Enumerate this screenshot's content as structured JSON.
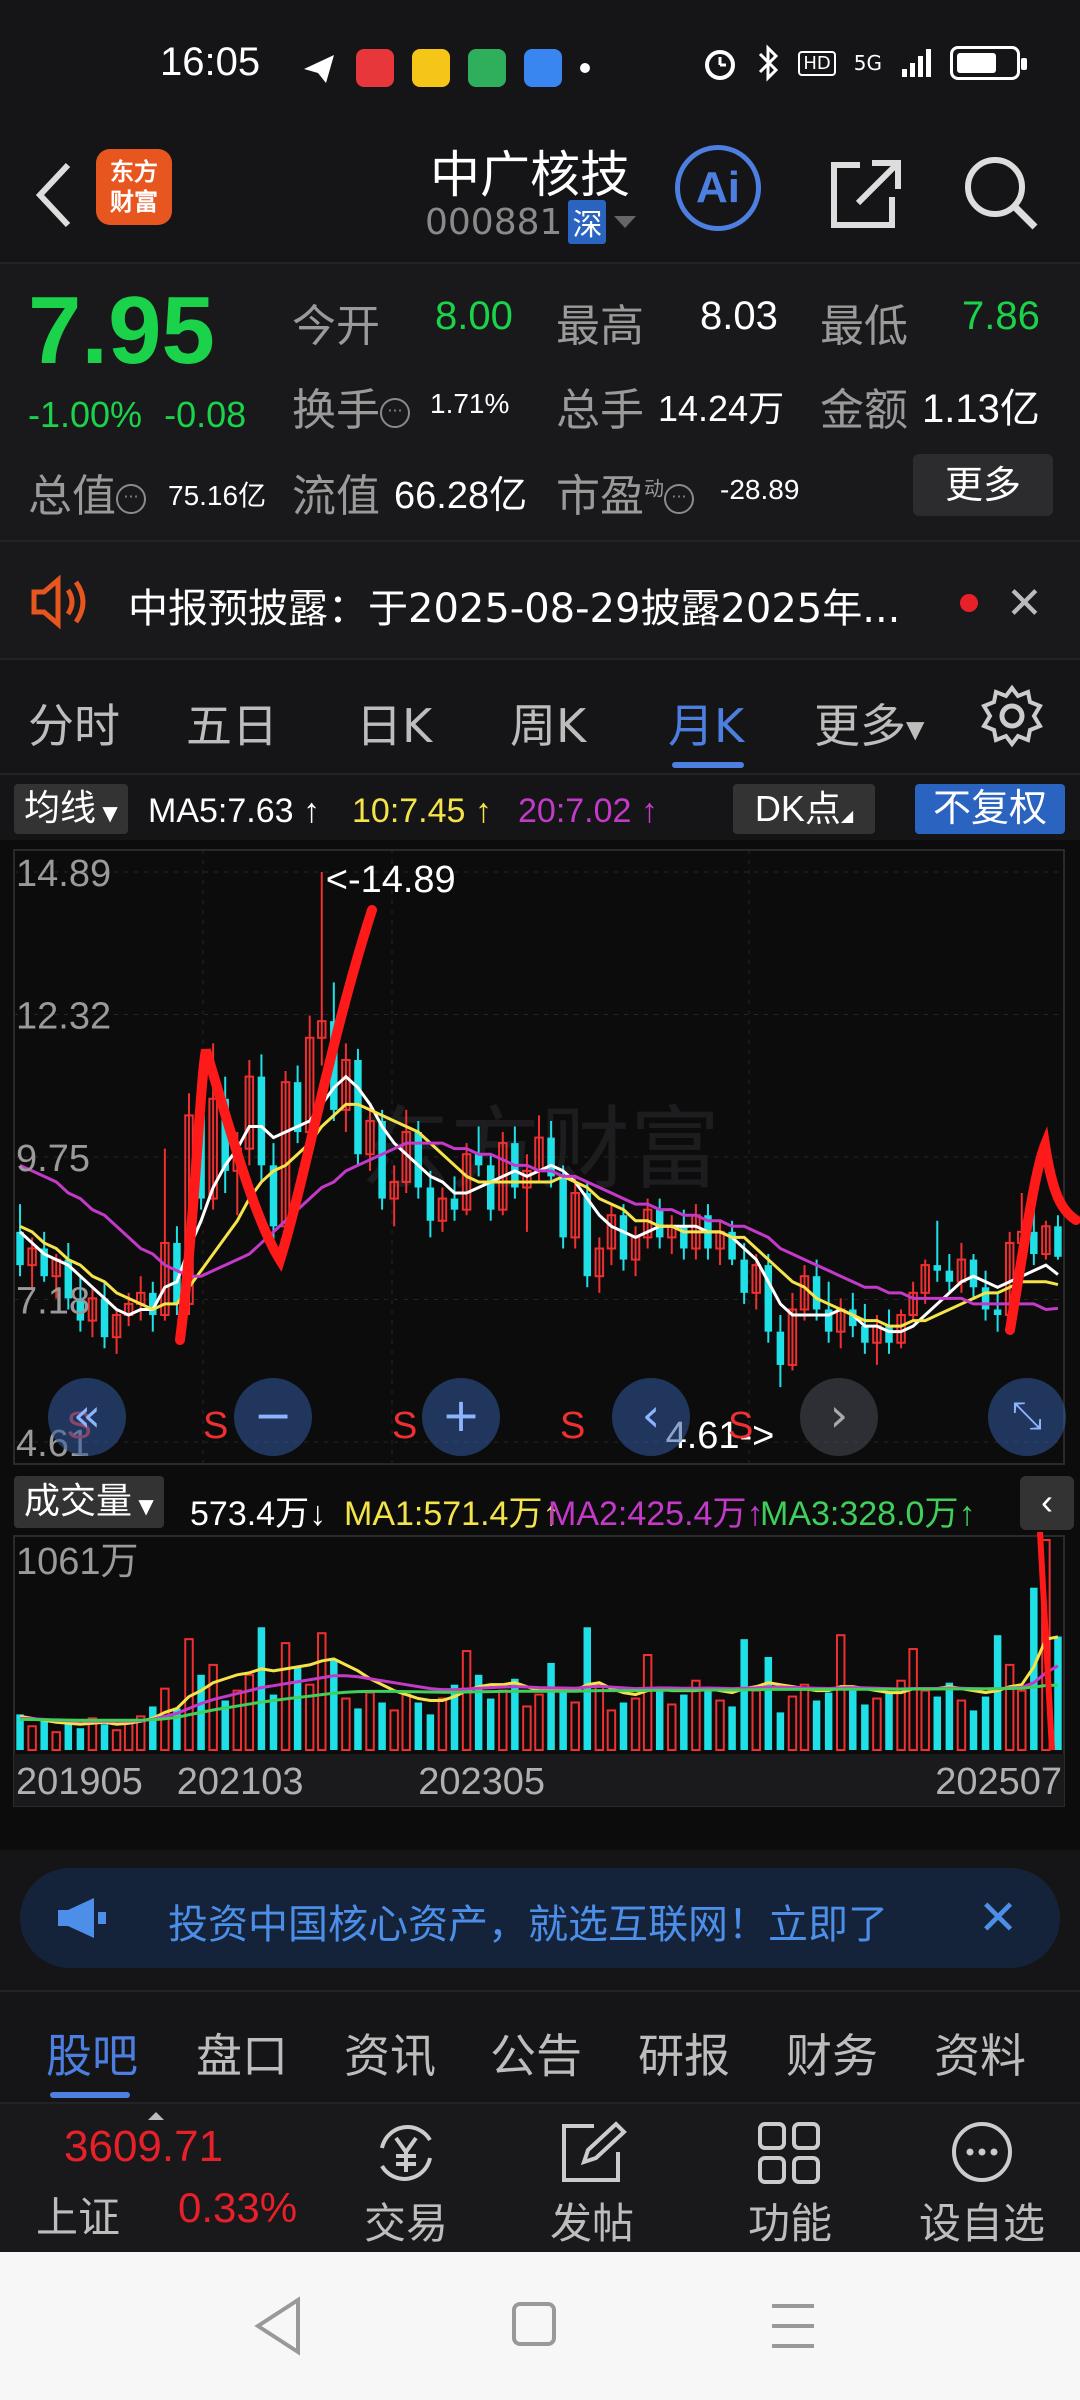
{
  "status": {
    "time": "16:05",
    "network": "5G",
    "battery_level": 0.7
  },
  "header": {
    "logo_text": "东方\n财富",
    "stock_name": "中广核技",
    "stock_code": "000881",
    "market": "深",
    "ai_label": "Ai"
  },
  "quote": {
    "price": "7.95",
    "change_pct": "-1.00%",
    "change_amt": "-0.08",
    "open_label": "今开",
    "open": "8.00",
    "high_label": "最高",
    "high": "8.03",
    "low_label": "最低",
    "low": "7.86",
    "turnover_label": "换手",
    "turnover": "1.71%",
    "volume_label": "总手",
    "volume": "14.24万",
    "amount_label": "金额",
    "amount": "1.13亿",
    "mktcap_label": "总值",
    "mktcap": "75.16亿",
    "float_label": "流值",
    "float": "66.28亿",
    "pe_label": "市盈",
    "pe_sup": "动",
    "pe": "-28.89",
    "more_label": "更多"
  },
  "notice": {
    "text": "中报预披露：于2025-08-29披露2025年..."
  },
  "tabs": [
    "分时",
    "五日",
    "日K",
    "周K",
    "月K",
    "更多"
  ],
  "active_tab": "月K",
  "ma_row": {
    "select_label": "均线",
    "ma5": "MA5:7.63",
    "ma10": "10:7.45",
    "ma20": "20:7.02",
    "dk_label": "DK点",
    "fq_label": "不复权"
  },
  "chart_labels": {
    "max_marker": "<-14.89",
    "min_marker": "4.61->",
    "s_marker": "S"
  },
  "volume_row": {
    "select_label": "成交量",
    "vol": "573.4万",
    "ma1": "MA1:571.4万",
    "ma2": "MA2:425.4万",
    "ma3": "MA3:328.0万",
    "max_label": "1061万"
  },
  "chart_data": {
    "type": "candlestick",
    "period": "monthly",
    "y_ticks": [
      "14.89",
      "12.32",
      "9.75",
      "7.18",
      "4.61"
    ],
    "ylim": [
      4.61,
      14.89
    ],
    "x_ticks": [
      "201905",
      "202103",
      "202305",
      "202507"
    ],
    "grid": true,
    "candles": [
      [
        8.4,
        8.9,
        7.6,
        7.8
      ],
      [
        7.8,
        8.3,
        7.4,
        8.1
      ],
      [
        8.1,
        8.4,
        7.5,
        7.6
      ],
      [
        7.6,
        8.0,
        7.2,
        7.9
      ],
      [
        7.9,
        8.2,
        7.0,
        7.2
      ],
      [
        7.2,
        7.6,
        6.6,
        6.8
      ],
      [
        6.8,
        7.4,
        6.5,
        7.2
      ],
      [
        7.2,
        7.5,
        6.3,
        6.5
      ],
      [
        6.5,
        7.0,
        6.2,
        6.9
      ],
      [
        6.9,
        7.3,
        6.7,
        7.1
      ],
      [
        7.1,
        7.6,
        6.8,
        7.3
      ],
      [
        7.3,
        7.5,
        6.6,
        6.9
      ],
      [
        6.9,
        9.9,
        6.8,
        8.2
      ],
      [
        8.2,
        8.5,
        6.9,
        7.1
      ],
      [
        7.1,
        10.9,
        6.9,
        10.5
      ],
      [
        10.5,
        11.0,
        8.8,
        9.0
      ],
      [
        9.0,
        11.8,
        8.8,
        10.8
      ],
      [
        10.8,
        11.2,
        9.1,
        9.5
      ],
      [
        9.5,
        10.2,
        8.7,
        9.9
      ],
      [
        9.9,
        11.5,
        9.6,
        11.2
      ],
      [
        11.2,
        11.6,
        9.3,
        9.6
      ],
      [
        9.6,
        10.0,
        8.2,
        8.5
      ],
      [
        8.5,
        11.3,
        8.3,
        11.1
      ],
      [
        11.1,
        11.4,
        10.0,
        10.2
      ],
      [
        10.2,
        12.3,
        10.0,
        11.9
      ],
      [
        11.9,
        14.89,
        11.4,
        12.2
      ],
      [
        12.2,
        12.9,
        10.4,
        10.6
      ],
      [
        10.6,
        11.8,
        10.2,
        11.5
      ],
      [
        11.5,
        11.7,
        9.6,
        9.8
      ],
      [
        9.8,
        10.7,
        9.5,
        10.4
      ],
      [
        10.4,
        10.6,
        8.8,
        9.0
      ],
      [
        9.0,
        9.6,
        8.5,
        9.3
      ],
      [
        9.3,
        10.6,
        9.1,
        10.2
      ],
      [
        10.2,
        10.4,
        9.0,
        9.2
      ],
      [
        9.2,
        9.5,
        8.3,
        8.6
      ],
      [
        8.6,
        9.2,
        8.4,
        9.0
      ],
      [
        9.0,
        9.4,
        8.6,
        8.8
      ],
      [
        8.8,
        10.0,
        8.7,
        9.8
      ],
      [
        9.8,
        10.3,
        9.4,
        9.6
      ],
      [
        9.6,
        9.8,
        8.6,
        8.8
      ],
      [
        8.8,
        10.2,
        8.7,
        10.0
      ],
      [
        10.0,
        10.3,
        9.0,
        9.2
      ],
      [
        9.2,
        9.8,
        8.4,
        9.5
      ],
      [
        9.5,
        10.5,
        9.3,
        10.1
      ],
      [
        10.1,
        10.4,
        9.2,
        9.4
      ],
      [
        9.4,
        9.6,
        8.1,
        8.3
      ],
      [
        8.3,
        9.4,
        8.1,
        9.1
      ],
      [
        9.1,
        9.3,
        7.4,
        7.6
      ],
      [
        7.6,
        8.3,
        7.3,
        8.1
      ],
      [
        8.1,
        8.9,
        7.8,
        8.7
      ],
      [
        8.7,
        8.9,
        7.7,
        7.9
      ],
      [
        7.9,
        8.5,
        7.6,
        8.3
      ],
      [
        8.3,
        9.0,
        8.1,
        8.8
      ],
      [
        8.8,
        9.0,
        8.1,
        8.3
      ],
      [
        8.3,
        8.7,
        8.0,
        8.5
      ],
      [
        8.5,
        8.8,
        7.9,
        8.1
      ],
      [
        8.1,
        8.9,
        7.9,
        8.7
      ],
      [
        8.7,
        8.9,
        7.9,
        8.1
      ],
      [
        8.1,
        8.6,
        7.8,
        8.4
      ],
      [
        8.4,
        8.6,
        7.8,
        7.9
      ],
      [
        7.9,
        8.2,
        7.1,
        7.3
      ],
      [
        7.3,
        8.0,
        7.0,
        7.8
      ],
      [
        7.8,
        8.0,
        6.4,
        6.6
      ],
      [
        6.6,
        6.9,
        5.6,
        6.0
      ],
      [
        6.0,
        7.3,
        5.9,
        7.0
      ],
      [
        7.0,
        7.8,
        6.8,
        7.6
      ],
      [
        7.6,
        7.9,
        6.8,
        7.0
      ],
      [
        7.0,
        7.5,
        6.4,
        6.6
      ],
      [
        6.6,
        7.2,
        6.3,
        7.0
      ],
      [
        7.0,
        7.3,
        6.5,
        6.7
      ],
      [
        6.7,
        7.1,
        6.2,
        6.4
      ],
      [
        6.4,
        6.9,
        6.0,
        6.7
      ],
      [
        6.7,
        7.0,
        6.2,
        6.4
      ],
      [
        6.4,
        7.0,
        6.3,
        6.9
      ],
      [
        6.9,
        7.5,
        6.8,
        7.3
      ],
      [
        7.3,
        7.9,
        7.1,
        7.8
      ],
      [
        7.8,
        8.6,
        7.5,
        7.7
      ],
      [
        7.7,
        8.0,
        7.3,
        7.5
      ],
      [
        7.5,
        8.2,
        7.3,
        7.9
      ],
      [
        7.9,
        8.0,
        7.2,
        7.4
      ],
      [
        7.4,
        7.7,
        6.8,
        7.0
      ],
      [
        7.0,
        7.3,
        6.6,
        6.9
      ],
      [
        6.9,
        8.4,
        6.8,
        8.2
      ],
      [
        8.2,
        9.1,
        7.9,
        8.4
      ],
      [
        8.4,
        8.8,
        7.8,
        8.0
      ],
      [
        8.0,
        8.6,
        7.9,
        8.5
      ],
      [
        8.5,
        8.7,
        7.9,
        7.95
      ]
    ],
    "ma_lines": [
      {
        "name": "MA5",
        "color": "#ffffff",
        "values": [
          8.4,
          8.2,
          8.0,
          7.9,
          7.8,
          7.6,
          7.4,
          7.2,
          7.0,
          6.9,
          7.0,
          7.0,
          7.4,
          7.5,
          8.1,
          8.6,
          9.2,
          9.6,
          9.9,
          10.3,
          10.3,
          10.1,
          10.2,
          10.3,
          10.4,
          10.7,
          11.0,
          11.2,
          11.0,
          10.7,
          10.3,
          10.0,
          9.8,
          9.6,
          9.4,
          9.3,
          9.1,
          9.1,
          9.2,
          9.3,
          9.4,
          9.5,
          9.4,
          9.5,
          9.6,
          9.5,
          9.3,
          9.0,
          8.7,
          8.5,
          8.4,
          8.3,
          8.4,
          8.5,
          8.5,
          8.5,
          8.5,
          8.4,
          8.4,
          8.3,
          8.1,
          7.9,
          7.5,
          7.1,
          6.9,
          6.9,
          6.9,
          6.9,
          7.0,
          6.9,
          6.7,
          6.7,
          6.6,
          6.6,
          6.7,
          6.9,
          7.1,
          7.3,
          7.5,
          7.6,
          7.5,
          7.4,
          7.5,
          7.6,
          7.7,
          7.8,
          7.63
        ]
      },
      {
        "name": "MA10",
        "color": "#f5e34a",
        "values": [
          8.5,
          8.4,
          8.2,
          8.1,
          7.9,
          7.8,
          7.6,
          7.5,
          7.3,
          7.2,
          7.1,
          7.0,
          7.1,
          7.1,
          7.4,
          7.7,
          8.0,
          8.3,
          8.6,
          9.0,
          9.3,
          9.5,
          9.6,
          9.8,
          10.0,
          10.3,
          10.5,
          10.7,
          10.7,
          10.6,
          10.5,
          10.4,
          10.3,
          10.2,
          10.0,
          9.8,
          9.6,
          9.4,
          9.3,
          9.3,
          9.3,
          9.3,
          9.3,
          9.3,
          9.3,
          9.4,
          9.3,
          9.2,
          9.0,
          8.9,
          8.8,
          8.6,
          8.6,
          8.5,
          8.5,
          8.4,
          8.4,
          8.4,
          8.4,
          8.3,
          8.3,
          8.1,
          7.9,
          7.7,
          7.5,
          7.4,
          7.2,
          7.1,
          7.0,
          6.9,
          6.8,
          6.8,
          6.7,
          6.7,
          6.8,
          6.8,
          6.9,
          7.0,
          7.1,
          7.2,
          7.3,
          7.3,
          7.4,
          7.5,
          7.5,
          7.5,
          7.45
        ]
      },
      {
        "name": "MA20",
        "color": "#c43ac8",
        "values": [
          9.6,
          9.5,
          9.4,
          9.3,
          9.1,
          9.0,
          8.8,
          8.7,
          8.5,
          8.3,
          8.1,
          8.0,
          7.8,
          7.7,
          7.6,
          7.6,
          7.7,
          7.8,
          7.9,
          8.0,
          8.2,
          8.4,
          8.6,
          8.8,
          9.0,
          9.2,
          9.3,
          9.5,
          9.6,
          9.7,
          9.8,
          9.9,
          10.0,
          10.0,
          10.0,
          10.0,
          9.9,
          9.9,
          9.8,
          9.8,
          9.7,
          9.6,
          9.6,
          9.5,
          9.5,
          9.4,
          9.4,
          9.3,
          9.2,
          9.1,
          9.0,
          8.9,
          8.9,
          8.8,
          8.8,
          8.7,
          8.7,
          8.6,
          8.6,
          8.5,
          8.5,
          8.4,
          8.3,
          8.1,
          8.0,
          7.9,
          7.8,
          7.7,
          7.6,
          7.5,
          7.4,
          7.4,
          7.3,
          7.3,
          7.2,
          7.2,
          7.2,
          7.2,
          7.2,
          7.1,
          7.1,
          7.1,
          7.1,
          7.1,
          7.1,
          7.0,
          7.02
        ]
      }
    ],
    "volume": [
      180,
      120,
      150,
      90,
      140,
      110,
      160,
      130,
      100,
      150,
      170,
      220,
      310,
      210,
      560,
      380,
      430,
      250,
      300,
      380,
      620,
      280,
      540,
      420,
      330,
      590,
      460,
      260,
      210,
      290,
      240,
      200,
      280,
      240,
      180,
      260,
      330,
      500,
      380,
      260,
      300,
      360,
      220,
      280,
      440,
      300,
      240,
      620,
      330,
      200,
      240,
      260,
      480,
      320,
      230,
      280,
      350,
      310,
      250,
      220,
      560,
      300,
      470,
      190,
      270,
      330,
      250,
      290,
      580,
      320,
      230,
      260,
      290,
      350,
      510,
      300,
      270,
      340,
      250,
      200,
      270,
      580,
      430,
      300,
      820,
      1061,
      573.4
    ],
    "volume_ma": [
      {
        "name": "MA1",
        "color": "#f5e34a",
        "values": [
          170,
          160,
          150,
          140,
          135,
          130,
          135,
          140,
          130,
          135,
          145,
          160,
          190,
          210,
          270,
          300,
          340,
          360,
          380,
          390,
          410,
          400,
          410,
          420,
          430,
          450,
          460,
          430,
          400,
          360,
          330,
          300,
          280,
          260,
          250,
          250,
          270,
          300,
          320,
          330,
          330,
          340,
          320,
          300,
          300,
          300,
          300,
          330,
          340,
          310,
          290,
          280,
          300,
          310,
          300,
          300,
          300,
          310,
          300,
          290,
          310,
          320,
          340,
          330,
          320,
          310,
          300,
          300,
          320,
          320,
          310,
          300,
          290,
          290,
          310,
          310,
          310,
          320,
          310,
          300,
          290,
          300,
          320,
          330,
          420,
          560,
          571.4
        ]
      },
      {
        "name": "MA2",
        "color": "#c43ac8",
        "values": [
          160,
          158,
          155,
          150,
          148,
          146,
          146,
          146,
          145,
          146,
          148,
          155,
          170,
          185,
          210,
          235,
          255,
          270,
          285,
          300,
          315,
          325,
          335,
          345,
          355,
          365,
          375,
          375,
          370,
          360,
          350,
          340,
          330,
          320,
          310,
          305,
          305,
          308,
          312,
          315,
          318,
          320,
          318,
          315,
          314,
          313,
          312,
          318,
          322,
          318,
          314,
          310,
          312,
          314,
          313,
          312,
          312,
          313,
          312,
          310,
          312,
          314,
          318,
          318,
          316,
          314,
          312,
          311,
          314,
          315,
          314,
          312,
          310,
          309,
          311,
          311,
          311,
          313,
          312,
          310,
          309,
          310,
          313,
          316,
          340,
          390,
          425.4
        ]
      },
      {
        "name": "MA3",
        "color": "#3fcf5a",
        "values": [
          155,
          154,
          153,
          152,
          151,
          150,
          150,
          150,
          150,
          150,
          151,
          153,
          158,
          165,
          178,
          190,
          202,
          212,
          222,
          232,
          242,
          250,
          258,
          265,
          272,
          280,
          287,
          292,
          295,
          296,
          296,
          296,
          295,
          294,
          293,
          292,
          292,
          293,
          294,
          295,
          296,
          297,
          297,
          297,
          297,
          297,
          297,
          299,
          300,
          300,
          300,
          300,
          301,
          302,
          302,
          302,
          302,
          303,
          303,
          303,
          304,
          305,
          306,
          306,
          306,
          306,
          306,
          306,
          307,
          307,
          307,
          307,
          307,
          307,
          308,
          308,
          308,
          309,
          309,
          309,
          309,
          310,
          311,
          312,
          318,
          326,
          328.0
        ]
      }
    ],
    "colors": {
      "up": "#f03030",
      "down": "#1fe0e6",
      "bg": "#0c0c0d"
    }
  },
  "chart_controls": [
    "«",
    "−",
    "+",
    "‹",
    "›",
    "⤡"
  ],
  "ad": {
    "text": "投资中国核心资产，就选互联网！立即了"
  },
  "bottom_tabs": [
    "股吧",
    "盘口",
    "资讯",
    "公告",
    "研报",
    "财务",
    "资料"
  ],
  "active_bottom_tab": "股吧",
  "toolbar": {
    "index_value": "3609.71",
    "index_name": "上证",
    "index_change": "0.33%",
    "trade_label": "交易",
    "post_label": "发帖",
    "func_label": "功能",
    "watch_label": "设自选"
  }
}
